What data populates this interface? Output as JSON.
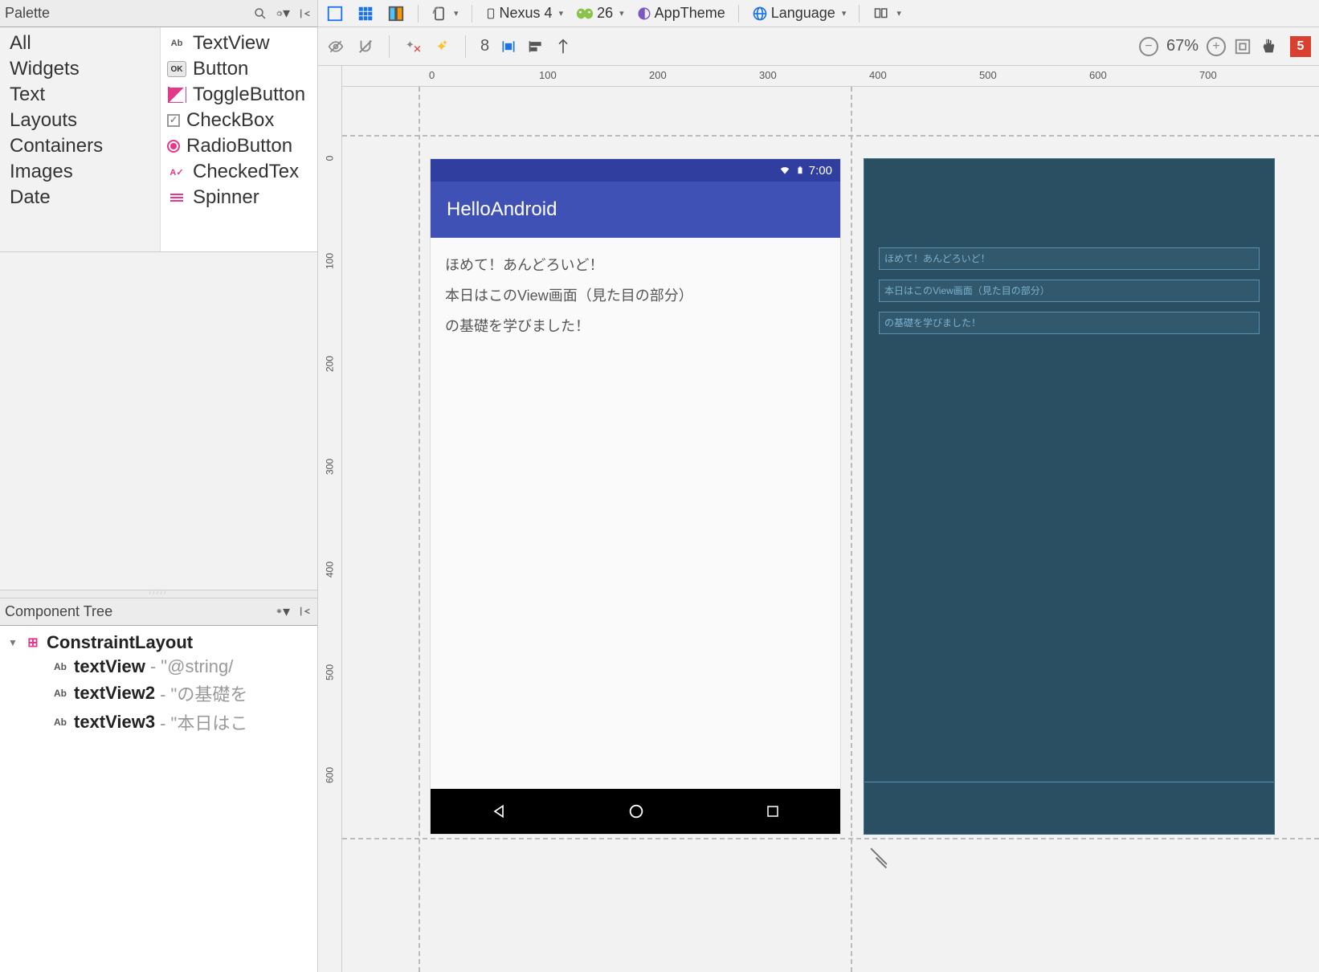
{
  "palette": {
    "title": "Palette",
    "categories": [
      "All",
      "Widgets",
      "Text",
      "Layouts",
      "Containers",
      "Images",
      "Date"
    ],
    "items": [
      {
        "icon": "ab",
        "label": "TextView"
      },
      {
        "icon": "ok",
        "label": "Button"
      },
      {
        "icon": "tog",
        "label": "ToggleButton"
      },
      {
        "icon": "cb",
        "label": "CheckBox"
      },
      {
        "icon": "rb",
        "label": "RadioButton"
      },
      {
        "icon": "ct",
        "label": "CheckedTex"
      },
      {
        "icon": "sp",
        "label": "Spinner"
      }
    ]
  },
  "componentTree": {
    "title": "Component Tree",
    "root": "ConstraintLayout",
    "children": [
      {
        "name": "textView",
        "suffix": " - \"@string/"
      },
      {
        "name": "textView2",
        "suffix": " - \"の基礎を"
      },
      {
        "name": "textView3",
        "suffix": " - \"本日はこ"
      }
    ]
  },
  "toolbar": {
    "device": "Nexus 4",
    "api": "26",
    "theme": "AppTheme",
    "language": "Language"
  },
  "toolbar2": {
    "number": "8",
    "zoom_pct": "67%",
    "errors": "5"
  },
  "ruler_h": [
    "0",
    "100",
    "200",
    "300",
    "400",
    "500",
    "600",
    "700"
  ],
  "ruler_v": [
    "0",
    "100",
    "200",
    "300",
    "400",
    "500",
    "600"
  ],
  "device": {
    "time": "7:00",
    "appTitle": "HelloAndroid",
    "text1": "ほめて！あんどろいど！",
    "text2": "本日はこのView画面（見た目の部分）",
    "text3": "の基礎を学びました！"
  },
  "blueprint": {
    "text1": "ほめて！あんどろいど！",
    "text2": "本日はこのView画面（見た目の部分）",
    "text3": "の基礎を学びました！"
  }
}
